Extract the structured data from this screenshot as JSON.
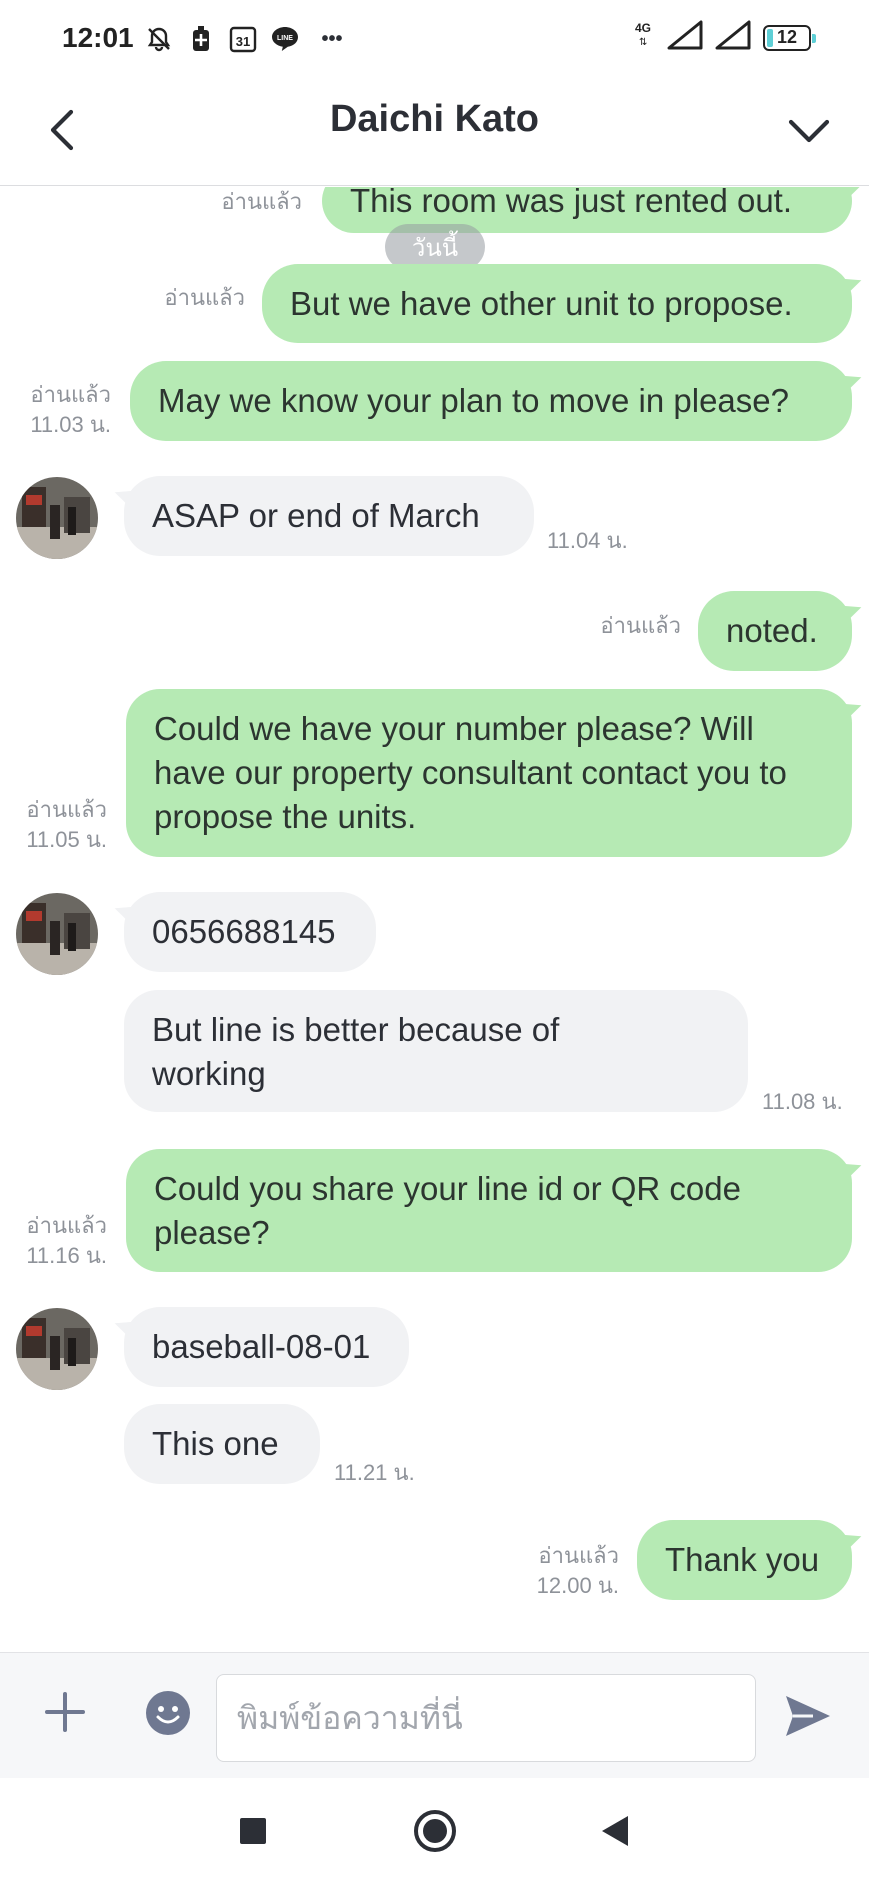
{
  "status_bar": {
    "time": "12:01",
    "calendar_day": "31",
    "more": "•••",
    "network": "4G",
    "battery": "12"
  },
  "header": {
    "title": "Daichi Kato"
  },
  "chat": {
    "date_divider": "วันนี้",
    "messages": [
      {
        "dir": "out",
        "text": "This room was just rented out.",
        "read": "อ่านแล้ว",
        "time": ""
      },
      {
        "dir": "out",
        "text": "But we have other unit to propose.",
        "read": "อ่านแล้ว",
        "time": ""
      },
      {
        "dir": "out",
        "text": "May we know your plan to move in please?",
        "read": "อ่านแล้ว",
        "time": "11.03 น."
      },
      {
        "dir": "in",
        "text": "ASAP or end of March",
        "time": "11.04 น."
      },
      {
        "dir": "out",
        "text": "noted.",
        "read": "อ่านแล้ว",
        "time": ""
      },
      {
        "dir": "out",
        "text": "Could we have your number please? Will have our property consultant contact you to propose the units.",
        "read": "อ่านแล้ว",
        "time": "11.05 น."
      },
      {
        "dir": "in",
        "text": "0656688145",
        "time": ""
      },
      {
        "dir": "in",
        "text": "But line is better because of working",
        "time": "11.08 น."
      },
      {
        "dir": "out",
        "text": "Could you share your line id or QR code please?",
        "read": "อ่านแล้ว",
        "time": "11.16 น."
      },
      {
        "dir": "in",
        "text": "baseball-08-01",
        "time": ""
      },
      {
        "dir": "in",
        "text": "This one",
        "time": "11.21 น."
      },
      {
        "dir": "out",
        "text": "Thank you",
        "read": "อ่านแล้ว",
        "time": "12.00 น."
      }
    ]
  },
  "input_bar": {
    "placeholder": "พิมพ์ข้อความที่นี่"
  },
  "colors": {
    "outgoing_bubble": "#b6eab4",
    "incoming_bubble": "#f1f2f4",
    "icon_gray": "#6f7891"
  }
}
